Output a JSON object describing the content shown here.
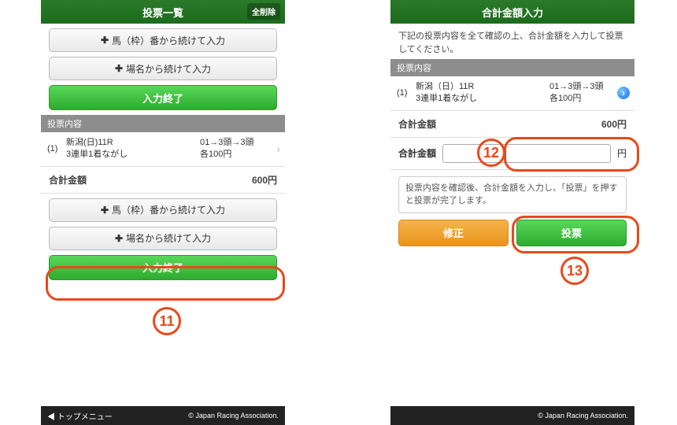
{
  "left": {
    "title": "投票一覧",
    "clear_all": "全削除",
    "add_number": "馬（枠）番から続けて入力",
    "add_venue": "場名から続けて入力",
    "finish": "入力終了",
    "section_head": "投票内容",
    "entry": {
      "idx": "(1)",
      "line1": "新潟(日)11R",
      "line2": "3連単1着ながし",
      "sel1": "01→3頭→3頭",
      "sel2": "各100円"
    },
    "total_label": "合計金額",
    "total_value": "600円",
    "footer_top": "◀ トップメニュー",
    "footer_copy": "© Japan Racing Association."
  },
  "right": {
    "title": "合計金額入力",
    "instruction": "下記の投票内容を全て確認の上、合計金額を入力して投票してください。",
    "section_head": "投票内容",
    "entry": {
      "idx": "(1)",
      "line1": "新潟（日）11R",
      "line2": "3連単1着ながし",
      "sel1": "01→3頭→3頭",
      "sel2": "各100円"
    },
    "total_label": "合計金額",
    "total_value": "600円",
    "input_label": "合計金額",
    "input_value": "",
    "yen": "円",
    "note": "投票内容を確認後、合計金額を入力し、「投票」を押すと投票が完了します。",
    "modify": "修正",
    "submit": "投票",
    "footer_copy": "© Japan Racing Association."
  },
  "callouts": {
    "n11": "11",
    "n12": "12",
    "n13": "13"
  },
  "icons": {
    "plus": "✚"
  }
}
